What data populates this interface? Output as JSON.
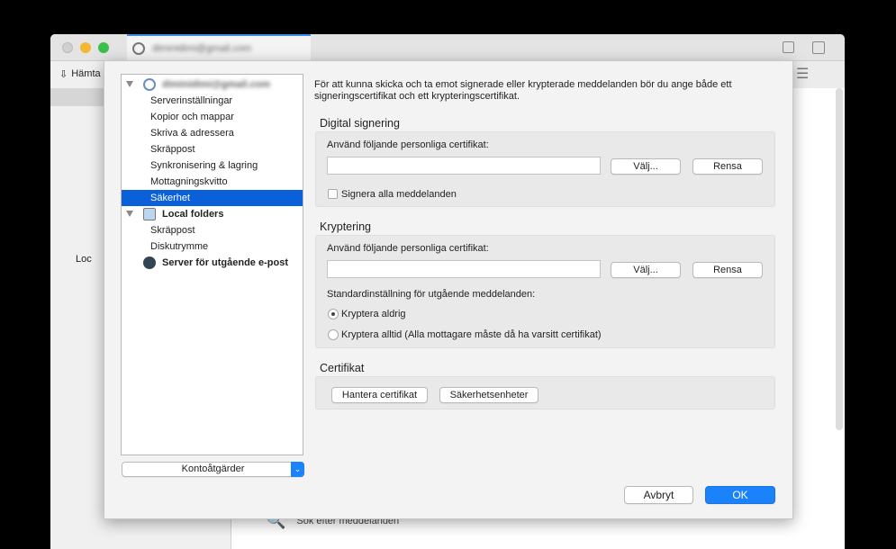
{
  "window": {
    "tab_title": "diminidimi@gmail.com",
    "get_messages_label": "Hämta",
    "local_label": "Loc",
    "search_messages": "Sök efter meddelanden"
  },
  "tree": {
    "account": "diminidimi@gmail.com",
    "items": [
      "Serverinställningar",
      "Kopior och mappar",
      "Skriva & adressera",
      "Skräppost",
      "Synkronisering & lagring",
      "Mottagningskvitto",
      "Säkerhet"
    ],
    "selected": "Säkerhet",
    "local_folders": "Local folders",
    "local_items": [
      "Skräppost",
      "Diskutrymme"
    ],
    "outgoing": "Server för utgående e-post"
  },
  "account_actions": "Kontoåtgärder",
  "intro": "För att kunna skicka och ta emot signerade eller krypterade meddelanden bör du ange både ett signeringscertifikat och ett krypteringscertifikat.",
  "signing": {
    "heading": "Digital signering",
    "label": "Använd följande personliga certifikat:",
    "value": "",
    "select": "Välj...",
    "clear": "Rensa",
    "sign_all": "Signera alla meddelanden",
    "sign_all_checked": false
  },
  "encryption": {
    "heading": "Kryptering",
    "label": "Använd följande personliga certifikat:",
    "value": "",
    "select": "Välj...",
    "clear": "Rensa",
    "default_label": "Standardinställning för utgående meddelanden:",
    "never": "Kryptera aldrig",
    "always": "Kryptera alltid (Alla mottagare måste då ha varsitt certifikat)",
    "selected": "never"
  },
  "certificates": {
    "heading": "Certifikat",
    "manage": "Hantera certifikat",
    "devices": "Säkerhetsenheter"
  },
  "footer": {
    "cancel": "Avbryt",
    "ok": "OK"
  },
  "colors": {
    "accent": "#0a60d8",
    "ok": "#1a82fb"
  }
}
